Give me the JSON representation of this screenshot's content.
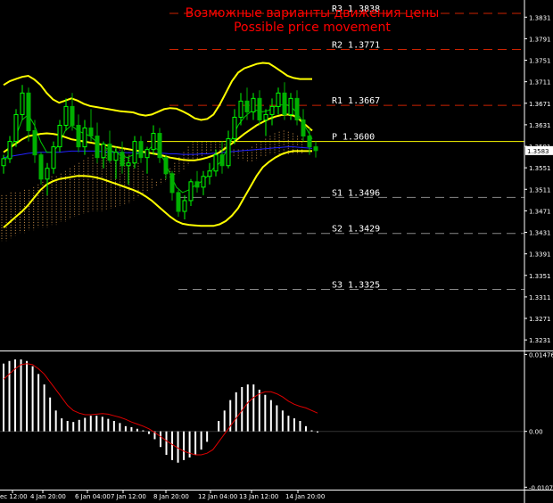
{
  "title_ru": "Возможные варианты движения цены",
  "title_en": "Possible price movement",
  "colors": {
    "background": "#000000",
    "bull_candle": "#00ff00",
    "bear_candle": "#00b000",
    "bollinger": "#ffff00",
    "ma_green": "#00cc00",
    "ma_blue": "#2222ff",
    "cloud": "#d2964e",
    "pivot_line": "#ffff00",
    "level_lines": "#cc2200",
    "support_lines": "#888888",
    "osc_bars": "#ffffff",
    "osc_signal": "#dd0000",
    "text": "#ffffff",
    "title": "#ff0000"
  },
  "chart_data": [
    {
      "type": "candlestick",
      "title": "Возможные варианты движения цены / Possible price movement",
      "y_ticks": [
        "1.3831",
        "1.3791",
        "1.3751",
        "1.3711",
        "1.3671",
        "1.3631",
        "1.3591",
        "1.3551",
        "1.3511",
        "1.3471",
        "1.3431",
        "1.3391",
        "1.3351",
        "1.3311",
        "1.3271",
        "1.3231"
      ],
      "ylim": [
        1.3213,
        1.3853
      ],
      "current_price": "1.3583",
      "current_price_value": 1.3583,
      "x_labels": [
        "ec 12:00",
        "4 Jan 20:00",
        "6 Jan 04:00",
        "7 Jan 12:00",
        "8 Jan 20:00",
        "12 Jan 04:00",
        "13 Jan 12:00",
        "14 Jan 20:00"
      ],
      "levels": [
        {
          "label": "R3 1.3838",
          "value": 1.3838,
          "kind": "resistance"
        },
        {
          "label": "R2 1.3771",
          "value": 1.3771,
          "kind": "resistance"
        },
        {
          "label": "R1 1.3667",
          "value": 1.3667,
          "kind": "resistance"
        },
        {
          "label": "P 1.3600",
          "value": 1.36,
          "kind": "pivot"
        },
        {
          "label": "S1 1.3496",
          "value": 1.3496,
          "kind": "support"
        },
        {
          "label": "S2 1.3429",
          "value": 1.3429,
          "kind": "support"
        },
        {
          "label": "S3 1.3325",
          "value": 1.3325,
          "kind": "support"
        }
      ],
      "candles": [
        [
          1.3555,
          1.3575,
          1.354,
          1.3568
        ],
        [
          1.3568,
          1.361,
          1.356,
          1.36
        ],
        [
          1.36,
          1.366,
          1.359,
          1.365
        ],
        [
          1.365,
          1.3705,
          1.364,
          1.369
        ],
        [
          1.369,
          1.37,
          1.36,
          1.362
        ],
        [
          1.362,
          1.364,
          1.356,
          1.3575
        ],
        [
          1.3575,
          1.358,
          1.352,
          1.353
        ],
        [
          1.353,
          1.356,
          1.35,
          1.355
        ],
        [
          1.355,
          1.36,
          1.354,
          1.359
        ],
        [
          1.359,
          1.364,
          1.358,
          1.363
        ],
        [
          1.363,
          1.368,
          1.362,
          1.3665
        ],
        [
          1.3665,
          1.369,
          1.362,
          1.363
        ],
        [
          1.363,
          1.365,
          1.358,
          1.359
        ],
        [
          1.359,
          1.364,
          1.3575,
          1.3625
        ],
        [
          1.3625,
          1.366,
          1.36,
          1.361
        ],
        [
          1.361,
          1.3635,
          1.356,
          1.357
        ],
        [
          1.357,
          1.36,
          1.355,
          1.3595
        ],
        [
          1.3595,
          1.362,
          1.356,
          1.3565
        ],
        [
          1.3565,
          1.359,
          1.353,
          1.358
        ],
        [
          1.358,
          1.36,
          1.354,
          1.3555
        ],
        [
          1.3555,
          1.357,
          1.352,
          1.356
        ],
        [
          1.356,
          1.361,
          1.355,
          1.36
        ],
        [
          1.36,
          1.361,
          1.356,
          1.357
        ],
        [
          1.357,
          1.359,
          1.354,
          1.3585
        ],
        [
          1.3585,
          1.363,
          1.3575,
          1.3615
        ],
        [
          1.3615,
          1.3625,
          1.356,
          1.357
        ],
        [
          1.357,
          1.3575,
          1.353,
          1.354
        ],
        [
          1.354,
          1.3545,
          1.349,
          1.3505
        ],
        [
          1.3505,
          1.351,
          1.346,
          1.347
        ],
        [
          1.347,
          1.35,
          1.3455,
          1.349
        ],
        [
          1.349,
          1.353,
          1.348,
          1.3525
        ],
        [
          1.3525,
          1.3545,
          1.3505,
          1.3515
        ],
        [
          1.3515,
          1.3545,
          1.35,
          1.3535
        ],
        [
          1.3535,
          1.356,
          1.352,
          1.3545
        ],
        [
          1.3545,
          1.3585,
          1.3535,
          1.3575
        ],
        [
          1.3575,
          1.36,
          1.354,
          1.3555
        ],
        [
          1.3555,
          1.362,
          1.355,
          1.3605
        ],
        [
          1.3605,
          1.366,
          1.3595,
          1.3645
        ],
        [
          1.3645,
          1.369,
          1.363,
          1.3675
        ],
        [
          1.3675,
          1.37,
          1.364,
          1.3655
        ],
        [
          1.3655,
          1.369,
          1.364,
          1.368
        ],
        [
          1.368,
          1.3695,
          1.363,
          1.364
        ],
        [
          1.364,
          1.366,
          1.361,
          1.365
        ],
        [
          1.365,
          1.368,
          1.363,
          1.3665
        ],
        [
          1.3665,
          1.37,
          1.365,
          1.369
        ],
        [
          1.369,
          1.371,
          1.364,
          1.365
        ],
        [
          1.365,
          1.369,
          1.364,
          1.368
        ],
        [
          1.368,
          1.3695,
          1.363,
          1.364
        ],
        [
          1.364,
          1.366,
          1.36,
          1.361
        ],
        [
          1.361,
          1.3625,
          1.3575,
          1.359
        ],
        [
          1.359,
          1.36,
          1.357,
          1.3583
        ]
      ],
      "bollinger_upper": [
        1.3705,
        1.3712,
        1.3716,
        1.372,
        1.3722,
        1.3715,
        1.3705,
        1.369,
        1.3678,
        1.3672,
        1.3676,
        1.368,
        1.3676,
        1.367,
        1.3666,
        1.3664,
        1.3662,
        1.366,
        1.3658,
        1.3656,
        1.3655,
        1.3654,
        1.365,
        1.3648,
        1.365,
        1.3655,
        1.366,
        1.3662,
        1.3661,
        1.3656,
        1.365,
        1.3643,
        1.364,
        1.3642,
        1.365,
        1.3668,
        1.369,
        1.3712,
        1.3728,
        1.3736,
        1.374,
        1.3744,
        1.3746,
        1.3745,
        1.3738,
        1.373,
        1.3722,
        1.3718,
        1.3716,
        1.3716,
        1.3716
      ],
      "bollinger_mid": [
        1.358,
        1.3588,
        1.3596,
        1.3604,
        1.361,
        1.3612,
        1.3614,
        1.3615,
        1.3614,
        1.3612,
        1.3608,
        1.3604,
        1.3602,
        1.36,
        1.3598,
        1.3596,
        1.3594,
        1.3592,
        1.359,
        1.3588,
        1.3586,
        1.3584,
        1.3582,
        1.358,
        1.3578,
        1.3576,
        1.3573,
        1.357,
        1.3568,
        1.3566,
        1.3565,
        1.3565,
        1.3567,
        1.357,
        1.3574,
        1.358,
        1.3588,
        1.3596,
        1.3605,
        1.3614,
        1.3622,
        1.363,
        1.3636,
        1.3642,
        1.3646,
        1.3649,
        1.365,
        1.3648,
        1.364,
        1.363,
        1.362
      ],
      "bollinger_lower": [
        1.344,
        1.345,
        1.346,
        1.347,
        1.3482,
        1.3496,
        1.351,
        1.352,
        1.3526,
        1.353,
        1.3532,
        1.3534,
        1.3536,
        1.3536,
        1.3535,
        1.3533,
        1.353,
        1.3526,
        1.3522,
        1.3518,
        1.3514,
        1.351,
        1.3505,
        1.3498,
        1.349,
        1.348,
        1.347,
        1.346,
        1.3452,
        1.3447,
        1.3445,
        1.3444,
        1.3443,
        1.3443,
        1.3443,
        1.3446,
        1.3452,
        1.3462,
        1.3476,
        1.3496,
        1.3516,
        1.3536,
        1.3552,
        1.3562,
        1.357,
        1.3576,
        1.358,
        1.3582,
        1.3582,
        1.3582,
        1.3582
      ],
      "ma_green": [
        1.356,
        1.358,
        1.361,
        1.364,
        1.365,
        1.363,
        1.36,
        1.358,
        1.358,
        1.3595,
        1.362,
        1.363,
        1.362,
        1.3615,
        1.361,
        1.36,
        1.3592,
        1.3585,
        1.358,
        1.3575,
        1.357,
        1.3575,
        1.3578,
        1.358,
        1.359,
        1.3585,
        1.3565,
        1.354,
        1.3515,
        1.3505,
        1.351,
        1.3518,
        1.3525,
        1.3535,
        1.355,
        1.356,
        1.358,
        1.3605,
        1.363,
        1.3645,
        1.3655,
        1.3658,
        1.3655,
        1.3658,
        1.3665,
        1.3668,
        1.3668,
        1.366,
        1.3645,
        1.3625,
        1.3605
      ],
      "ma_blue": [
        1.357,
        1.3572,
        1.3574,
        1.3576,
        1.3578,
        1.3579,
        1.358,
        1.358,
        1.358,
        1.358,
        1.3581,
        1.3582,
        1.3582,
        1.3582,
        1.3582,
        1.3582,
        1.3581,
        1.358,
        1.358,
        1.358,
        1.3579,
        1.3579,
        1.3579,
        1.3579,
        1.3578,
        1.3578,
        1.3578,
        1.3577,
        1.3577,
        1.3576,
        1.3576,
        1.3576,
        1.3577,
        1.3577,
        1.3578,
        1.3579,
        1.358,
        1.3581,
        1.3582,
        1.3583,
        1.3584,
        1.3585,
        1.3586,
        1.3587,
        1.3588,
        1.3589,
        1.359,
        1.359,
        1.3589,
        1.3588,
        1.3587
      ],
      "cloud_top": [
        1.35,
        1.35,
        1.3505,
        1.3505,
        1.3505,
        1.351,
        1.351,
        1.3515,
        1.352,
        1.3525,
        1.353,
        1.3535,
        1.3535,
        1.354,
        1.3545,
        1.355,
        1.3555,
        1.356,
        1.3565,
        1.357,
        1.3575,
        1.358,
        1.3585,
        1.3585,
        1.3585,
        1.3585,
        1.3585,
        1.3585,
        1.358,
        1.3575,
        1.356,
        1.3545,
        1.3535,
        1.353,
        1.3525,
        1.353,
        1.354,
        1.355,
        1.356,
        1.357,
        1.358,
        1.359,
        1.36,
        1.36,
        1.36,
        1.36,
        1.36,
        1.36,
        1.36,
        1.3595,
        1.359,
        1.3585,
        1.3585,
        1.3585,
        1.3585,
        1.359,
        1.3595,
        1.36,
        1.3605,
        1.361,
        1.3615,
        1.3618,
        1.362,
        1.3618,
        1.3615,
        1.361,
        1.3605
      ],
      "cloud_bottom": [
        1.3415,
        1.3415,
        1.342,
        1.3425,
        1.343,
        1.343,
        1.3435,
        1.3435,
        1.344,
        1.344,
        1.344,
        1.3445,
        1.3445,
        1.345,
        1.345,
        1.3455,
        1.346,
        1.3462,
        1.3465,
        1.3468,
        1.347,
        1.347,
        1.347,
        1.3472,
        1.3475,
        1.3478,
        1.348,
        1.3482,
        1.3485,
        1.349,
        1.3495,
        1.35,
        1.3505,
        1.351,
        1.3515,
        1.352,
        1.3525,
        1.353,
        1.3535,
        1.354,
        1.3548,
        1.3555,
        1.356,
        1.3565,
        1.357,
        1.3575,
        1.358,
        1.3582,
        1.3582,
        1.358,
        1.3575,
        1.3572,
        1.3568,
        1.3565,
        1.3563,
        1.3563,
        1.3565,
        1.357,
        1.3572,
        1.3575,
        1.3575,
        1.3575,
        1.3575,
        1.3575,
        1.3575,
        1.3575,
        1.3575
      ]
    },
    {
      "type": "bar",
      "y_ticks": [
        "0.01476",
        "0.00",
        "-0.01071"
      ],
      "ylim": [
        -0.011,
        0.015
      ],
      "bars": [
        0.013,
        0.0135,
        0.0138,
        0.0138,
        0.0135,
        0.0125,
        0.011,
        0.009,
        0.0065,
        0.004,
        0.0025,
        0.002,
        0.0018,
        0.0022,
        0.0026,
        0.003,
        0.003,
        0.0028,
        0.0024,
        0.002,
        0.0016,
        0.001,
        0.0008,
        0.0005,
        0.0002,
        -0.0005,
        -0.0015,
        -0.003,
        -0.0045,
        -0.0055,
        -0.006,
        -0.0055,
        -0.005,
        -0.0045,
        -0.0035,
        -0.002,
        0.0,
        0.002,
        0.004,
        0.006,
        0.0075,
        0.0085,
        0.009,
        0.009,
        0.008,
        0.007,
        0.006,
        0.005,
        0.004,
        0.003,
        0.0025,
        0.002,
        0.001,
        0.0002,
        -0.0002
      ],
      "signal": [
        0.01,
        0.011,
        0.012,
        0.0128,
        0.013,
        0.0128,
        0.012,
        0.011,
        0.0095,
        0.008,
        0.0065,
        0.005,
        0.004,
        0.0035,
        0.0032,
        0.0032,
        0.0033,
        0.0034,
        0.0033,
        0.003,
        0.0027,
        0.0023,
        0.0018,
        0.0014,
        0.001,
        0.0005,
        -0.0002,
        -0.001,
        -0.0018,
        -0.0025,
        -0.0032,
        -0.0038,
        -0.0042,
        -0.0045,
        -0.0045,
        -0.0042,
        -0.0035,
        -0.002,
        -0.0005,
        0.001,
        0.0025,
        0.004,
        0.0055,
        0.0065,
        0.0072,
        0.0076,
        0.0076,
        0.0072,
        0.0066,
        0.0058,
        0.0052,
        0.0048,
        0.0045,
        0.004,
        0.0035
      ]
    }
  ]
}
